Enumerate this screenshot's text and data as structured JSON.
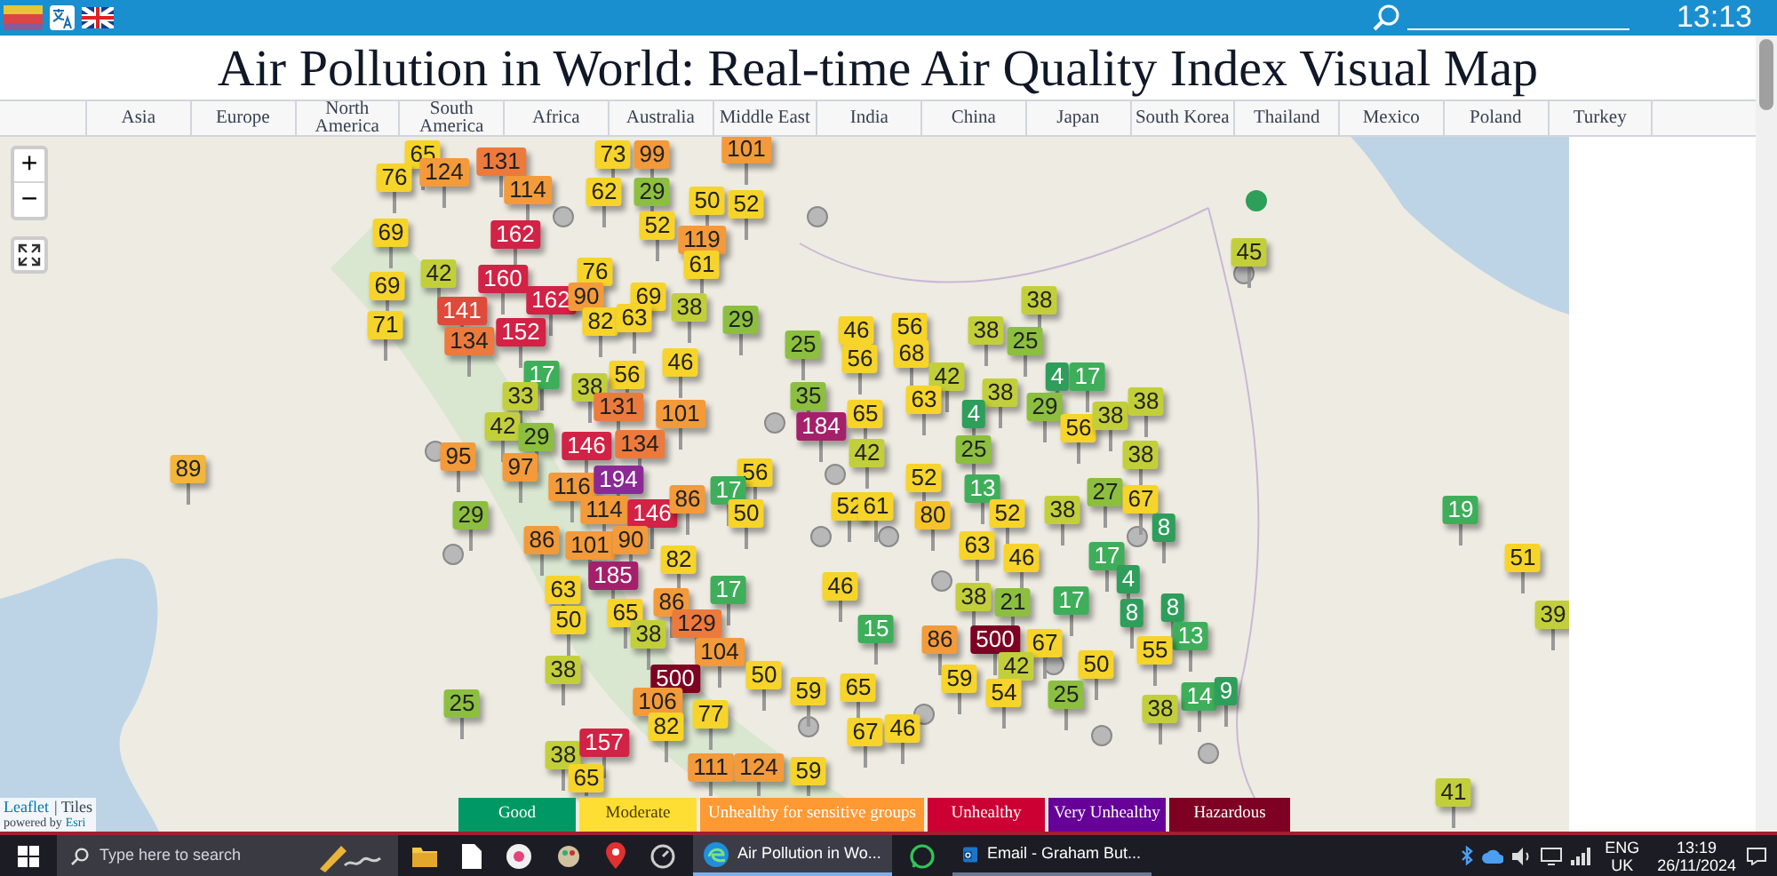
{
  "top_bar": {
    "time": "13:13"
  },
  "title": "Air Pollution in World: Real-time Air Quality Index Visual Map",
  "nav_tabs": [
    {
      "label": "Asia"
    },
    {
      "label": "Europe"
    },
    {
      "label": "North America"
    },
    {
      "label": "South America"
    },
    {
      "label": "Africa"
    },
    {
      "label": "Australia"
    },
    {
      "label": "Middle East"
    },
    {
      "label": "India"
    },
    {
      "label": "China"
    },
    {
      "label": "Japan"
    },
    {
      "label": "South Korea"
    },
    {
      "label": "Thailand"
    },
    {
      "label": "Mexico"
    },
    {
      "label": "Poland"
    },
    {
      "label": "Turkey"
    }
  ],
  "map": {
    "zoom_in": "+",
    "zoom_out": "−",
    "markers": [
      {
        "value": "65",
        "color": "#f6d42a"
      },
      {
        "value": "76",
        "color": "#f6d42a"
      },
      {
        "value": "124",
        "color": "#f39a3a"
      },
      {
        "value": "131",
        "color": "#ec7a3c"
      },
      {
        "value": "114",
        "color": "#f39a3a"
      },
      {
        "value": "73",
        "color": "#f6d42a"
      },
      {
        "value": "99",
        "color": "#f39a3a"
      },
      {
        "value": "62",
        "color": "#f6d42a"
      },
      {
        "value": "29",
        "color": "#8cbf3f"
      },
      {
        "value": "101",
        "color": "#f39a3a"
      },
      {
        "value": "50",
        "color": "#f6d42a"
      },
      {
        "value": "52",
        "color": "#f6d42a"
      },
      {
        "value": "69",
        "color": "#f6d42a"
      },
      {
        "value": "162",
        "color": "#d22245"
      },
      {
        "value": "52",
        "color": "#f6d42a"
      },
      {
        "value": "119",
        "color": "#f39a3a"
      },
      {
        "value": "69",
        "color": "#f6d42a"
      },
      {
        "value": "42",
        "color": "#c3cf3a"
      },
      {
        "value": "160",
        "color": "#d22245"
      },
      {
        "value": "76",
        "color": "#f6d42a"
      },
      {
        "value": "61",
        "color": "#f6d42a"
      },
      {
        "value": "162",
        "color": "#d22245"
      },
      {
        "value": "90",
        "color": "#f39a3a"
      },
      {
        "value": "69",
        "color": "#f6d42a"
      },
      {
        "value": "141",
        "color": "#e04a3a"
      },
      {
        "value": "38",
        "color": "#c3cf3a"
      },
      {
        "value": "71",
        "color": "#f6d42a"
      },
      {
        "value": "82",
        "color": "#f6d42a"
      },
      {
        "value": "63",
        "color": "#f6d42a"
      },
      {
        "value": "29",
        "color": "#8cbf3f"
      },
      {
        "value": "134",
        "color": "#ec7a3c"
      },
      {
        "value": "152",
        "color": "#d22245"
      },
      {
        "value": "17",
        "color": "#3fae5a"
      },
      {
        "value": "56",
        "color": "#f6d42a"
      },
      {
        "value": "46",
        "color": "#f6d42a"
      },
      {
        "value": "33",
        "color": "#c3cf3a"
      },
      {
        "value": "38",
        "color": "#c3cf3a"
      },
      {
        "value": "42",
        "color": "#c3cf3a"
      },
      {
        "value": "131",
        "color": "#ec7a3c"
      },
      {
        "value": "101",
        "color": "#f39a3a"
      },
      {
        "value": "29",
        "color": "#8cbf3f"
      },
      {
        "value": "95",
        "color": "#f39a3a"
      },
      {
        "value": "146",
        "color": "#d22245"
      },
      {
        "value": "134",
        "color": "#ec7a3c"
      },
      {
        "value": "97",
        "color": "#f39a3a"
      },
      {
        "value": "116",
        "color": "#f39a3a"
      },
      {
        "value": "194",
        "color": "#8b2a94"
      },
      {
        "value": "56",
        "color": "#f6d42a"
      },
      {
        "value": "29",
        "color": "#8cbf3f"
      },
      {
        "value": "114",
        "color": "#f39a3a"
      },
      {
        "value": "146",
        "color": "#d22245"
      },
      {
        "value": "86",
        "color": "#f39a3a"
      },
      {
        "value": "17",
        "color": "#3fae5a"
      },
      {
        "value": "50",
        "color": "#f6d42a"
      },
      {
        "value": "86",
        "color": "#f39a3a"
      },
      {
        "value": "101",
        "color": "#f39a3a"
      },
      {
        "value": "90",
        "color": "#f39a3a"
      },
      {
        "value": "82",
        "color": "#f6d42a"
      },
      {
        "value": "185",
        "color": "#a5206b"
      },
      {
        "value": "63",
        "color": "#f6d42a"
      },
      {
        "value": "17",
        "color": "#3fae5a"
      },
      {
        "value": "65",
        "color": "#f6d42a"
      },
      {
        "value": "86",
        "color": "#f39a3a"
      },
      {
        "value": "50",
        "color": "#f6d42a"
      },
      {
        "value": "38",
        "color": "#c3cf3a"
      },
      {
        "value": "129",
        "color": "#ec7a3c"
      },
      {
        "value": "38",
        "color": "#c3cf3a"
      },
      {
        "value": "104",
        "color": "#f39a3a"
      },
      {
        "value": "500",
        "color": "#7e0023"
      },
      {
        "value": "50",
        "color": "#f6d42a"
      },
      {
        "value": "106",
        "color": "#f39a3a"
      },
      {
        "value": "82",
        "color": "#f6d42a"
      },
      {
        "value": "77",
        "color": "#f6d42a"
      },
      {
        "value": "25",
        "color": "#8cbf3f"
      },
      {
        "value": "38",
        "color": "#c3cf3a"
      },
      {
        "value": "157",
        "color": "#d22245"
      },
      {
        "value": "65",
        "color": "#f6d42a"
      },
      {
        "value": "111",
        "color": "#f39a3a"
      },
      {
        "value": "124",
        "color": "#f39a3a"
      },
      {
        "value": "38",
        "color": "#c3cf3a"
      },
      {
        "value": "25",
        "color": "#8cbf3f"
      },
      {
        "value": "46",
        "color": "#f6d42a"
      },
      {
        "value": "56",
        "color": "#f6d42a"
      },
      {
        "value": "68",
        "color": "#f6d42a"
      },
      {
        "value": "38",
        "color": "#c3cf3a"
      },
      {
        "value": "25",
        "color": "#8cbf3f"
      },
      {
        "value": "56",
        "color": "#f6d42a"
      },
      {
        "value": "42",
        "color": "#c3cf3a"
      },
      {
        "value": "4",
        "color": "#2e9e5b"
      },
      {
        "value": "17",
        "color": "#3fae5a"
      },
      {
        "value": "35",
        "color": "#8cbf3f"
      },
      {
        "value": "63",
        "color": "#f6d42a"
      },
      {
        "value": "38",
        "color": "#c3cf3a"
      },
      {
        "value": "184",
        "color": "#a5206b"
      },
      {
        "value": "65",
        "color": "#f6d42a"
      },
      {
        "value": "4",
        "color": "#2e9e5b"
      },
      {
        "value": "29",
        "color": "#8cbf3f"
      },
      {
        "value": "56",
        "color": "#f6d42a"
      },
      {
        "value": "38",
        "color": "#c3cf3a"
      },
      {
        "value": "38",
        "color": "#c3cf3a"
      },
      {
        "value": "42",
        "color": "#c3cf3a"
      },
      {
        "value": "25",
        "color": "#8cbf3f"
      },
      {
        "value": "38",
        "color": "#c3cf3a"
      },
      {
        "value": "52",
        "color": "#f6d42a"
      },
      {
        "value": "13",
        "color": "#3fae5a"
      },
      {
        "value": "27",
        "color": "#8cbf3f"
      },
      {
        "value": "52",
        "color": "#f6d42a"
      },
      {
        "value": "61",
        "color": "#f6d42a"
      },
      {
        "value": "67",
        "color": "#f6d42a"
      },
      {
        "value": "80",
        "color": "#f6c42a"
      },
      {
        "value": "52",
        "color": "#f6d42a"
      },
      {
        "value": "38",
        "color": "#c3cf3a"
      },
      {
        "value": "8",
        "color": "#2e9e5b"
      },
      {
        "value": "63",
        "color": "#f6d42a"
      },
      {
        "value": "46",
        "color": "#f6d42a"
      },
      {
        "value": "17",
        "color": "#3fae5a"
      },
      {
        "value": "46",
        "color": "#f6d42a"
      },
      {
        "value": "38",
        "color": "#c3cf3a"
      },
      {
        "value": "21",
        "color": "#8cbf3f"
      },
      {
        "value": "17",
        "color": "#3fae5a"
      },
      {
        "value": "4",
        "color": "#2e9e5b"
      },
      {
        "value": "8",
        "color": "#2e9e5b"
      },
      {
        "value": "8",
        "color": "#2e9e5b"
      },
      {
        "value": "15",
        "color": "#3fae5a"
      },
      {
        "value": "86",
        "color": "#f39a3a"
      },
      {
        "value": "500",
        "color": "#7e0023"
      },
      {
        "value": "67",
        "color": "#f6d42a"
      },
      {
        "value": "13",
        "color": "#3fae5a"
      },
      {
        "value": "55",
        "color": "#f6d42a"
      },
      {
        "value": "42",
        "color": "#c3cf3a"
      },
      {
        "value": "50",
        "color": "#f6d42a"
      },
      {
        "value": "59",
        "color": "#f6d42a"
      },
      {
        "value": "65",
        "color": "#f6d42a"
      },
      {
        "value": "59",
        "color": "#f6d42a"
      },
      {
        "value": "54",
        "color": "#f6d42a"
      },
      {
        "value": "25",
        "color": "#8cbf3f"
      },
      {
        "value": "14",
        "color": "#3fae5a"
      },
      {
        "value": "9",
        "color": "#2e9e5b"
      },
      {
        "value": "38",
        "color": "#c3cf3a"
      },
      {
        "value": "67",
        "color": "#f6d42a"
      },
      {
        "value": "46",
        "color": "#f6d42a"
      },
      {
        "value": "89",
        "color": "#f3b53a"
      },
      {
        "value": "45",
        "color": "#c3cf3a"
      },
      {
        "value": "19",
        "color": "#3fae5a"
      },
      {
        "value": "51",
        "color": "#f6d42a"
      },
      {
        "value": "39",
        "color": "#c3cf3a"
      },
      {
        "value": "41",
        "color": "#c3cf3a"
      },
      {
        "value": "59",
        "color": "#f6d42a"
      }
    ],
    "attribution": {
      "leaflet": "Leaflet",
      "tiles": "| Tiles",
      "powered_by": "powered by",
      "esri": "Esri"
    }
  },
  "legend": [
    {
      "label": "Good",
      "color": "#009966"
    },
    {
      "label": "Moderate",
      "color": "#ffde33"
    },
    {
      "label": "Unhealthy for sensitive groups",
      "color": "#ff9933"
    },
    {
      "label": "Unhealthy",
      "color": "#cc0033"
    },
    {
      "label": "Very Unhealthy",
      "color": "#660099"
    },
    {
      "label": "Hazardous",
      "color": "#7e0023"
    }
  ],
  "taskbar": {
    "search_placeholder": "Type here to search",
    "windows": [
      {
        "label": "Air Pollution in Wo...",
        "selected": true
      },
      {
        "label": "Email - Graham But...",
        "selected": false
      }
    ],
    "language": "ENG",
    "region": "UK",
    "time": "13:19",
    "date": "26/11/2024"
  }
}
